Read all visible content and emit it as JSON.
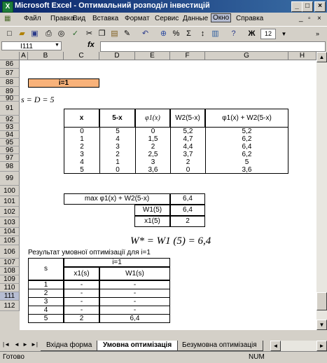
{
  "window": {
    "app_title": "Microsoft Excel",
    "title_sep": " - ",
    "doc_title": "Оптимальний розподіл інвестицій",
    "app_icon": "X"
  },
  "menu": {
    "items": [
      "Файл",
      "Правка",
      "Вид",
      "Вставка",
      "Формат",
      "Сервис",
      "Данные",
      "Окно",
      "Справка"
    ],
    "selected_index": 7
  },
  "toolbar": {
    "percent_label": "%",
    "sigma_label": "Σ",
    "bold_label": "Ж",
    "font_size_value": "12"
  },
  "formula_bar": {
    "name_box": "I111",
    "fx_label": "fx",
    "formula": ""
  },
  "columns": [
    "A",
    "B",
    "C",
    "D",
    "E",
    "F",
    "G",
    "H"
  ],
  "rows": [
    "86",
    "87",
    "88",
    "89",
    "90",
    "91",
    "92",
    "93",
    "94",
    "95",
    "96",
    "97",
    "98",
    "99",
    "100",
    "101",
    "102",
    "103",
    "104",
    "105",
    "106",
    "107",
    "108",
    "109",
    "110",
    "111",
    "112"
  ],
  "sheet": {
    "i_label": "i=1",
    "s_formula": "s = D = 5",
    "table1": {
      "headers": [
        "x",
        "5-x",
        "φ1(x)",
        "W2(5-x)",
        "φ1(x) + W2(5-x)"
      ],
      "rows": [
        [
          "0",
          "5",
          "0",
          "5,2",
          "5,2"
        ],
        [
          "1",
          "4",
          "1,5",
          "4,7",
          "6,2"
        ],
        [
          "2",
          "3",
          "2",
          "4,4",
          "6,4"
        ],
        [
          "3",
          "2",
          "2,5",
          "3,7",
          "6,2"
        ],
        [
          "4",
          "1",
          "3",
          "2",
          "5"
        ],
        [
          "5",
          "0",
          "3,6",
          "0",
          "3,6"
        ]
      ]
    },
    "table2": {
      "max_label": "max φ1(x) + W2(5-x)",
      "max_value": "6,4",
      "w1_label": "W1(5)",
      "w1_value": "6,4",
      "x1_label": "x1(5)",
      "x1_value": "2"
    },
    "w_star": "W* = W1 (5) = 6,4",
    "result_title": "Результат умовної оптимізації для i=1",
    "table3": {
      "s_header": "s",
      "i_header": "i=1",
      "x_header": "x1(s)",
      "w_header": "W1(s)",
      "rows": [
        [
          "1",
          "-",
          "-"
        ],
        [
          "2",
          "-",
          "-"
        ],
        [
          "3",
          "-",
          "-"
        ],
        [
          "4",
          "-",
          "-"
        ],
        [
          "5",
          "2",
          "6,4"
        ]
      ]
    }
  },
  "tabs": {
    "nav": [
      "|◄",
      "◄",
      "►",
      "►|"
    ],
    "items": [
      "Вхідна форма",
      "Умовна оптимізація",
      "Безумовна оптимізація"
    ],
    "active_index": 1
  },
  "status": {
    "left": "Готово",
    "num": "NUM"
  }
}
